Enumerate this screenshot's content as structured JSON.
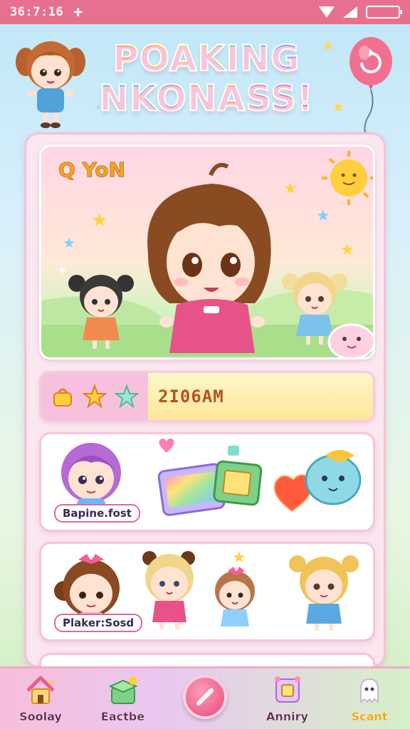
{
  "status_bar": {
    "time": "36:7:16",
    "plus_glyph": "+"
  },
  "header": {
    "title_line1": "POAKING",
    "title_line2": "NKONASS!"
  },
  "hero": {
    "badge": "Q YoN"
  },
  "banner": {
    "label": "2I06AM"
  },
  "cards": [
    {
      "name_tag": "Bapine.fost"
    },
    {
      "name_tag": "Plaker:Sosd"
    }
  ],
  "nav": {
    "items": [
      {
        "label": "Soolay",
        "icon": "house-icon"
      },
      {
        "label": "Eactbe",
        "icon": "gift-box-icon"
      },
      {
        "label": "",
        "icon": "pencil-icon"
      },
      {
        "label": "Anniry",
        "icon": "photo-frame-icon"
      },
      {
        "label": "Scant",
        "icon": "ghost-icon"
      }
    ]
  },
  "colors": {
    "accent": "#e8708f",
    "panel": "#fbe7f0",
    "active_nav": "#f4a300"
  }
}
